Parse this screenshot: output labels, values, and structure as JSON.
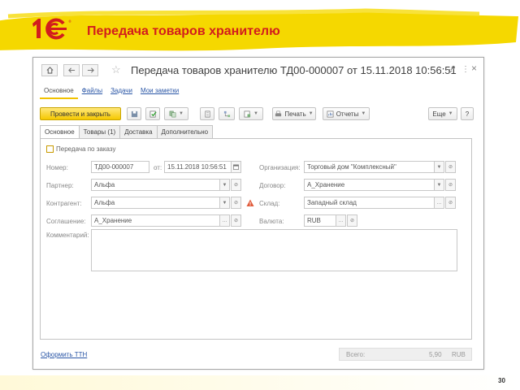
{
  "slide": {
    "title": "Передача товаров хранителю",
    "page_number": "30",
    "brand_color": "#f5d800",
    "title_color": "#d21d1d"
  },
  "window": {
    "title": "Передача товаров хранителю ТД00-000007 от 15.11.2018 10:56:51",
    "nav": {
      "home_icon": "home-icon",
      "back_icon": "arrow-left-icon",
      "forward_icon": "arrow-right-icon",
      "favorite_icon": "star-icon"
    },
    "controls": {
      "link_icon": "link-icon",
      "more": "⋮",
      "close": "×"
    }
  },
  "navlinks": [
    {
      "label": "Основное",
      "active": true
    },
    {
      "label": "Файлы"
    },
    {
      "label": "Задачи"
    },
    {
      "label": "Мои заметки"
    }
  ],
  "commandbar": {
    "post_close": "Провести и закрыть",
    "print": "Печать",
    "reports": "Отчеты",
    "more": "Еще",
    "help": "?"
  },
  "tabs": [
    "Основное",
    "Товары (1)",
    "Доставка",
    "Дополнительно"
  ],
  "form": {
    "by_order_label": "Передача по заказу",
    "number_label": "Номер:",
    "number_value": "ТД00-000007",
    "date_label": "от:",
    "date_value": "15.11.2018 10:56:51",
    "partner_label": "Партнер:",
    "partner_value": "Альфа",
    "counterparty_label": "Контрагент:",
    "counterparty_value": "Альфа",
    "agreement_label": "Соглашение:",
    "agreement_value": "А_Хранение",
    "comment_label": "Комментарий:",
    "organization_label": "Организация:",
    "organization_value": "Торговый дом \"Комплексный\"",
    "contract_label": "Договор:",
    "contract_value": "А_Хранение",
    "warehouse_label": "Склад:",
    "warehouse_value": "Западный склад",
    "currency_label": "Валюта:",
    "currency_value": "RUB"
  },
  "footer": {
    "ttn_link": "Оформить ТТН",
    "total_label": "Всего:",
    "total_value": "5,90",
    "total_currency": "RUB"
  }
}
